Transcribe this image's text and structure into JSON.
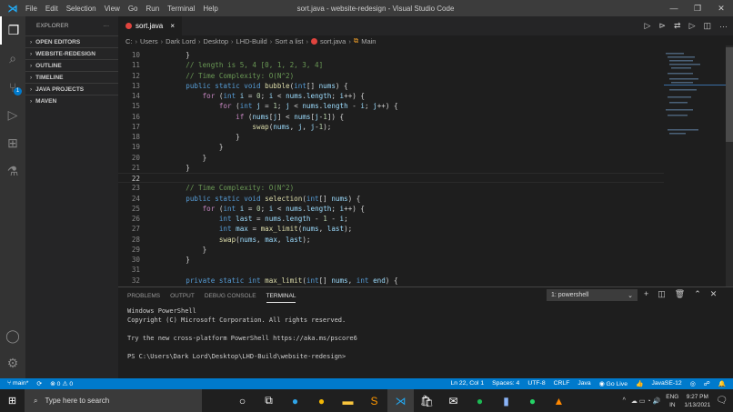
{
  "titlebar": {
    "menu": [
      "File",
      "Edit",
      "Selection",
      "View",
      "Go",
      "Run",
      "Terminal",
      "Help"
    ],
    "title": "sort.java - website-redesign - Visual Studio Code"
  },
  "activity": {
    "scm_badge": "1"
  },
  "sidebar": {
    "title": "EXPLORER",
    "more": "···",
    "sections": [
      "OPEN EDITORS",
      "WEBSITE-REDESIGN",
      "OUTLINE",
      "TIMELINE",
      "JAVA PROJECTS",
      "MAVEN"
    ]
  },
  "tab": {
    "label": "sort.java",
    "close": "×"
  },
  "breadcrumbs": [
    "C:",
    "Users",
    "Dark Lord",
    "Desktop",
    "LHD-Build",
    "Sort a list",
    "sort.java",
    "Main"
  ],
  "code": [
    {
      "n": "10",
      "t": [
        [
          "    }",
          "pl"
        ]
      ]
    },
    {
      "n": "11",
      "t": [
        [
          "    // length is 5, 4 [0, 1, 2, 3, 4]",
          "cm"
        ]
      ]
    },
    {
      "n": "12",
      "t": [
        [
          "    // Time Complexity: O(N^2)",
          "cm"
        ]
      ]
    },
    {
      "n": "13",
      "t": [
        [
          "    public static void ",
          "kw"
        ],
        [
          "bubble",
          "fn"
        ],
        [
          "(",
          "pl"
        ],
        [
          "int",
          "kw"
        ],
        [
          "[] ",
          "pl"
        ],
        [
          "nums",
          "var"
        ],
        [
          ") {",
          "pl"
        ]
      ]
    },
    {
      "n": "14",
      "t": [
        [
          "        for",
          "ctl"
        ],
        [
          " (",
          "pl"
        ],
        [
          "int ",
          "kw"
        ],
        [
          "i",
          "var"
        ],
        [
          " = ",
          "pl"
        ],
        [
          "0",
          "num"
        ],
        [
          "; ",
          "pl"
        ],
        [
          "i",
          "var"
        ],
        [
          " < ",
          "pl"
        ],
        [
          "nums",
          "var"
        ],
        [
          ".",
          "pl"
        ],
        [
          "length",
          "var"
        ],
        [
          "; ",
          "pl"
        ],
        [
          "i",
          "var"
        ],
        [
          "++) {",
          "pl"
        ]
      ]
    },
    {
      "n": "15",
      "t": [
        [
          "            for",
          "ctl"
        ],
        [
          " (",
          "pl"
        ],
        [
          "int ",
          "kw"
        ],
        [
          "j",
          "var"
        ],
        [
          " = ",
          "pl"
        ],
        [
          "1",
          "num"
        ],
        [
          "; ",
          "pl"
        ],
        [
          "j",
          "var"
        ],
        [
          " < ",
          "pl"
        ],
        [
          "nums",
          "var"
        ],
        [
          ".",
          "pl"
        ],
        [
          "length",
          "var"
        ],
        [
          " - ",
          "pl"
        ],
        [
          "i",
          "var"
        ],
        [
          "; ",
          "pl"
        ],
        [
          "j",
          "var"
        ],
        [
          "++) {",
          "pl"
        ]
      ]
    },
    {
      "n": "16",
      "t": [
        [
          "                if",
          "ctl"
        ],
        [
          " (",
          "pl"
        ],
        [
          "nums",
          "var"
        ],
        [
          "[",
          "pl"
        ],
        [
          "j",
          "var"
        ],
        [
          "] < ",
          "pl"
        ],
        [
          "nums",
          "var"
        ],
        [
          "[",
          "pl"
        ],
        [
          "j",
          "var"
        ],
        [
          "-",
          "pl"
        ],
        [
          "1",
          "num"
        ],
        [
          "]) {",
          "pl"
        ]
      ]
    },
    {
      "n": "17",
      "t": [
        [
          "                    swap",
          "fn"
        ],
        [
          "(",
          "pl"
        ],
        [
          "nums",
          "var"
        ],
        [
          ", ",
          "pl"
        ],
        [
          "j",
          "var"
        ],
        [
          ", ",
          "pl"
        ],
        [
          "j",
          "var"
        ],
        [
          "-",
          "pl"
        ],
        [
          "1",
          "num"
        ],
        [
          ");",
          "pl"
        ]
      ]
    },
    {
      "n": "18",
      "t": [
        [
          "                }",
          "pl"
        ]
      ]
    },
    {
      "n": "19",
      "t": [
        [
          "            }",
          "pl"
        ]
      ]
    },
    {
      "n": "20",
      "t": [
        [
          "        }",
          "pl"
        ]
      ]
    },
    {
      "n": "21",
      "t": [
        [
          "    }",
          "pl"
        ]
      ]
    },
    {
      "n": "22",
      "t": [
        [
          "",
          "pl"
        ]
      ],
      "cur": true
    },
    {
      "n": "23",
      "t": [
        [
          "    // Time Complexity: O(N^2)",
          "cm"
        ]
      ]
    },
    {
      "n": "24",
      "t": [
        [
          "    public static void ",
          "kw"
        ],
        [
          "selection",
          "fn"
        ],
        [
          "(",
          "pl"
        ],
        [
          "int",
          "kw"
        ],
        [
          "[] ",
          "pl"
        ],
        [
          "nums",
          "var"
        ],
        [
          ") {",
          "pl"
        ]
      ]
    },
    {
      "n": "25",
      "t": [
        [
          "        for",
          "ctl"
        ],
        [
          " (",
          "pl"
        ],
        [
          "int ",
          "kw"
        ],
        [
          "i",
          "var"
        ],
        [
          " = ",
          "pl"
        ],
        [
          "0",
          "num"
        ],
        [
          "; ",
          "pl"
        ],
        [
          "i",
          "var"
        ],
        [
          " < ",
          "pl"
        ],
        [
          "nums",
          "var"
        ],
        [
          ".",
          "pl"
        ],
        [
          "length",
          "var"
        ],
        [
          "; ",
          "pl"
        ],
        [
          "i",
          "var"
        ],
        [
          "++) {",
          "pl"
        ]
      ]
    },
    {
      "n": "26",
      "t": [
        [
          "            int ",
          "kw"
        ],
        [
          "last",
          "var"
        ],
        [
          " = ",
          "pl"
        ],
        [
          "nums",
          "var"
        ],
        [
          ".",
          "pl"
        ],
        [
          "length",
          "var"
        ],
        [
          " - ",
          "pl"
        ],
        [
          "1",
          "num"
        ],
        [
          " - ",
          "pl"
        ],
        [
          "i",
          "var"
        ],
        [
          ";",
          "pl"
        ]
      ]
    },
    {
      "n": "27",
      "t": [
        [
          "            int ",
          "kw"
        ],
        [
          "max",
          "var"
        ],
        [
          " = ",
          "pl"
        ],
        [
          "max_limit",
          "fn"
        ],
        [
          "(",
          "pl"
        ],
        [
          "nums",
          "var"
        ],
        [
          ", ",
          "pl"
        ],
        [
          "last",
          "var"
        ],
        [
          ");",
          "pl"
        ]
      ]
    },
    {
      "n": "28",
      "t": [
        [
          "            swap",
          "fn"
        ],
        [
          "(",
          "pl"
        ],
        [
          "nums",
          "var"
        ],
        [
          ", ",
          "pl"
        ],
        [
          "max",
          "var"
        ],
        [
          ", ",
          "pl"
        ],
        [
          "last",
          "var"
        ],
        [
          ");",
          "pl"
        ]
      ]
    },
    {
      "n": "29",
      "t": [
        [
          "        }",
          "pl"
        ]
      ]
    },
    {
      "n": "30",
      "t": [
        [
          "    }",
          "pl"
        ]
      ]
    },
    {
      "n": "31",
      "t": [
        [
          "",
          "pl"
        ]
      ]
    },
    {
      "n": "32",
      "t": [
        [
          "    private static int ",
          "kw"
        ],
        [
          "max_limit",
          "fn"
        ],
        [
          "(",
          "pl"
        ],
        [
          "int",
          "kw"
        ],
        [
          "[] ",
          "pl"
        ],
        [
          "nums",
          "var"
        ],
        [
          ", ",
          "pl"
        ],
        [
          "int ",
          "kw"
        ],
        [
          "end",
          "var"
        ],
        [
          ") {",
          "pl"
        ]
      ]
    }
  ],
  "panel": {
    "tabs": [
      "PROBLEMS",
      "OUTPUT",
      "DEBUG CONSOLE",
      "TERMINAL"
    ],
    "terminal_select": "1: powershell",
    "terminal_lines": [
      "Windows PowerShell",
      "Copyright (C) Microsoft Corporation. All rights reserved.",
      "",
      "Try the new cross-platform PowerShell https://aka.ms/pscore6",
      "",
      "PS C:\\Users\\Dark Lord\\Desktop\\LHD-Build\\website-redesign>"
    ]
  },
  "status": {
    "branch": "main*",
    "errors": "0",
    "warnings": "0",
    "position": "Ln 22, Col 1",
    "spaces": "Spaces: 4",
    "encoding": "UTF-8",
    "eol": "CRLF",
    "language": "Java",
    "golive": "Go Live",
    "jdk": "JavaSE-12"
  },
  "taskbar": {
    "search_placeholder": "Type here to search",
    "lang1": "ENG",
    "lang2": "IN",
    "time": "9:27 PM",
    "date": "1/13/2021"
  },
  "colors": {
    "accent": "#007acc",
    "keyword": "#569cd6",
    "comment": "#6a9955"
  }
}
